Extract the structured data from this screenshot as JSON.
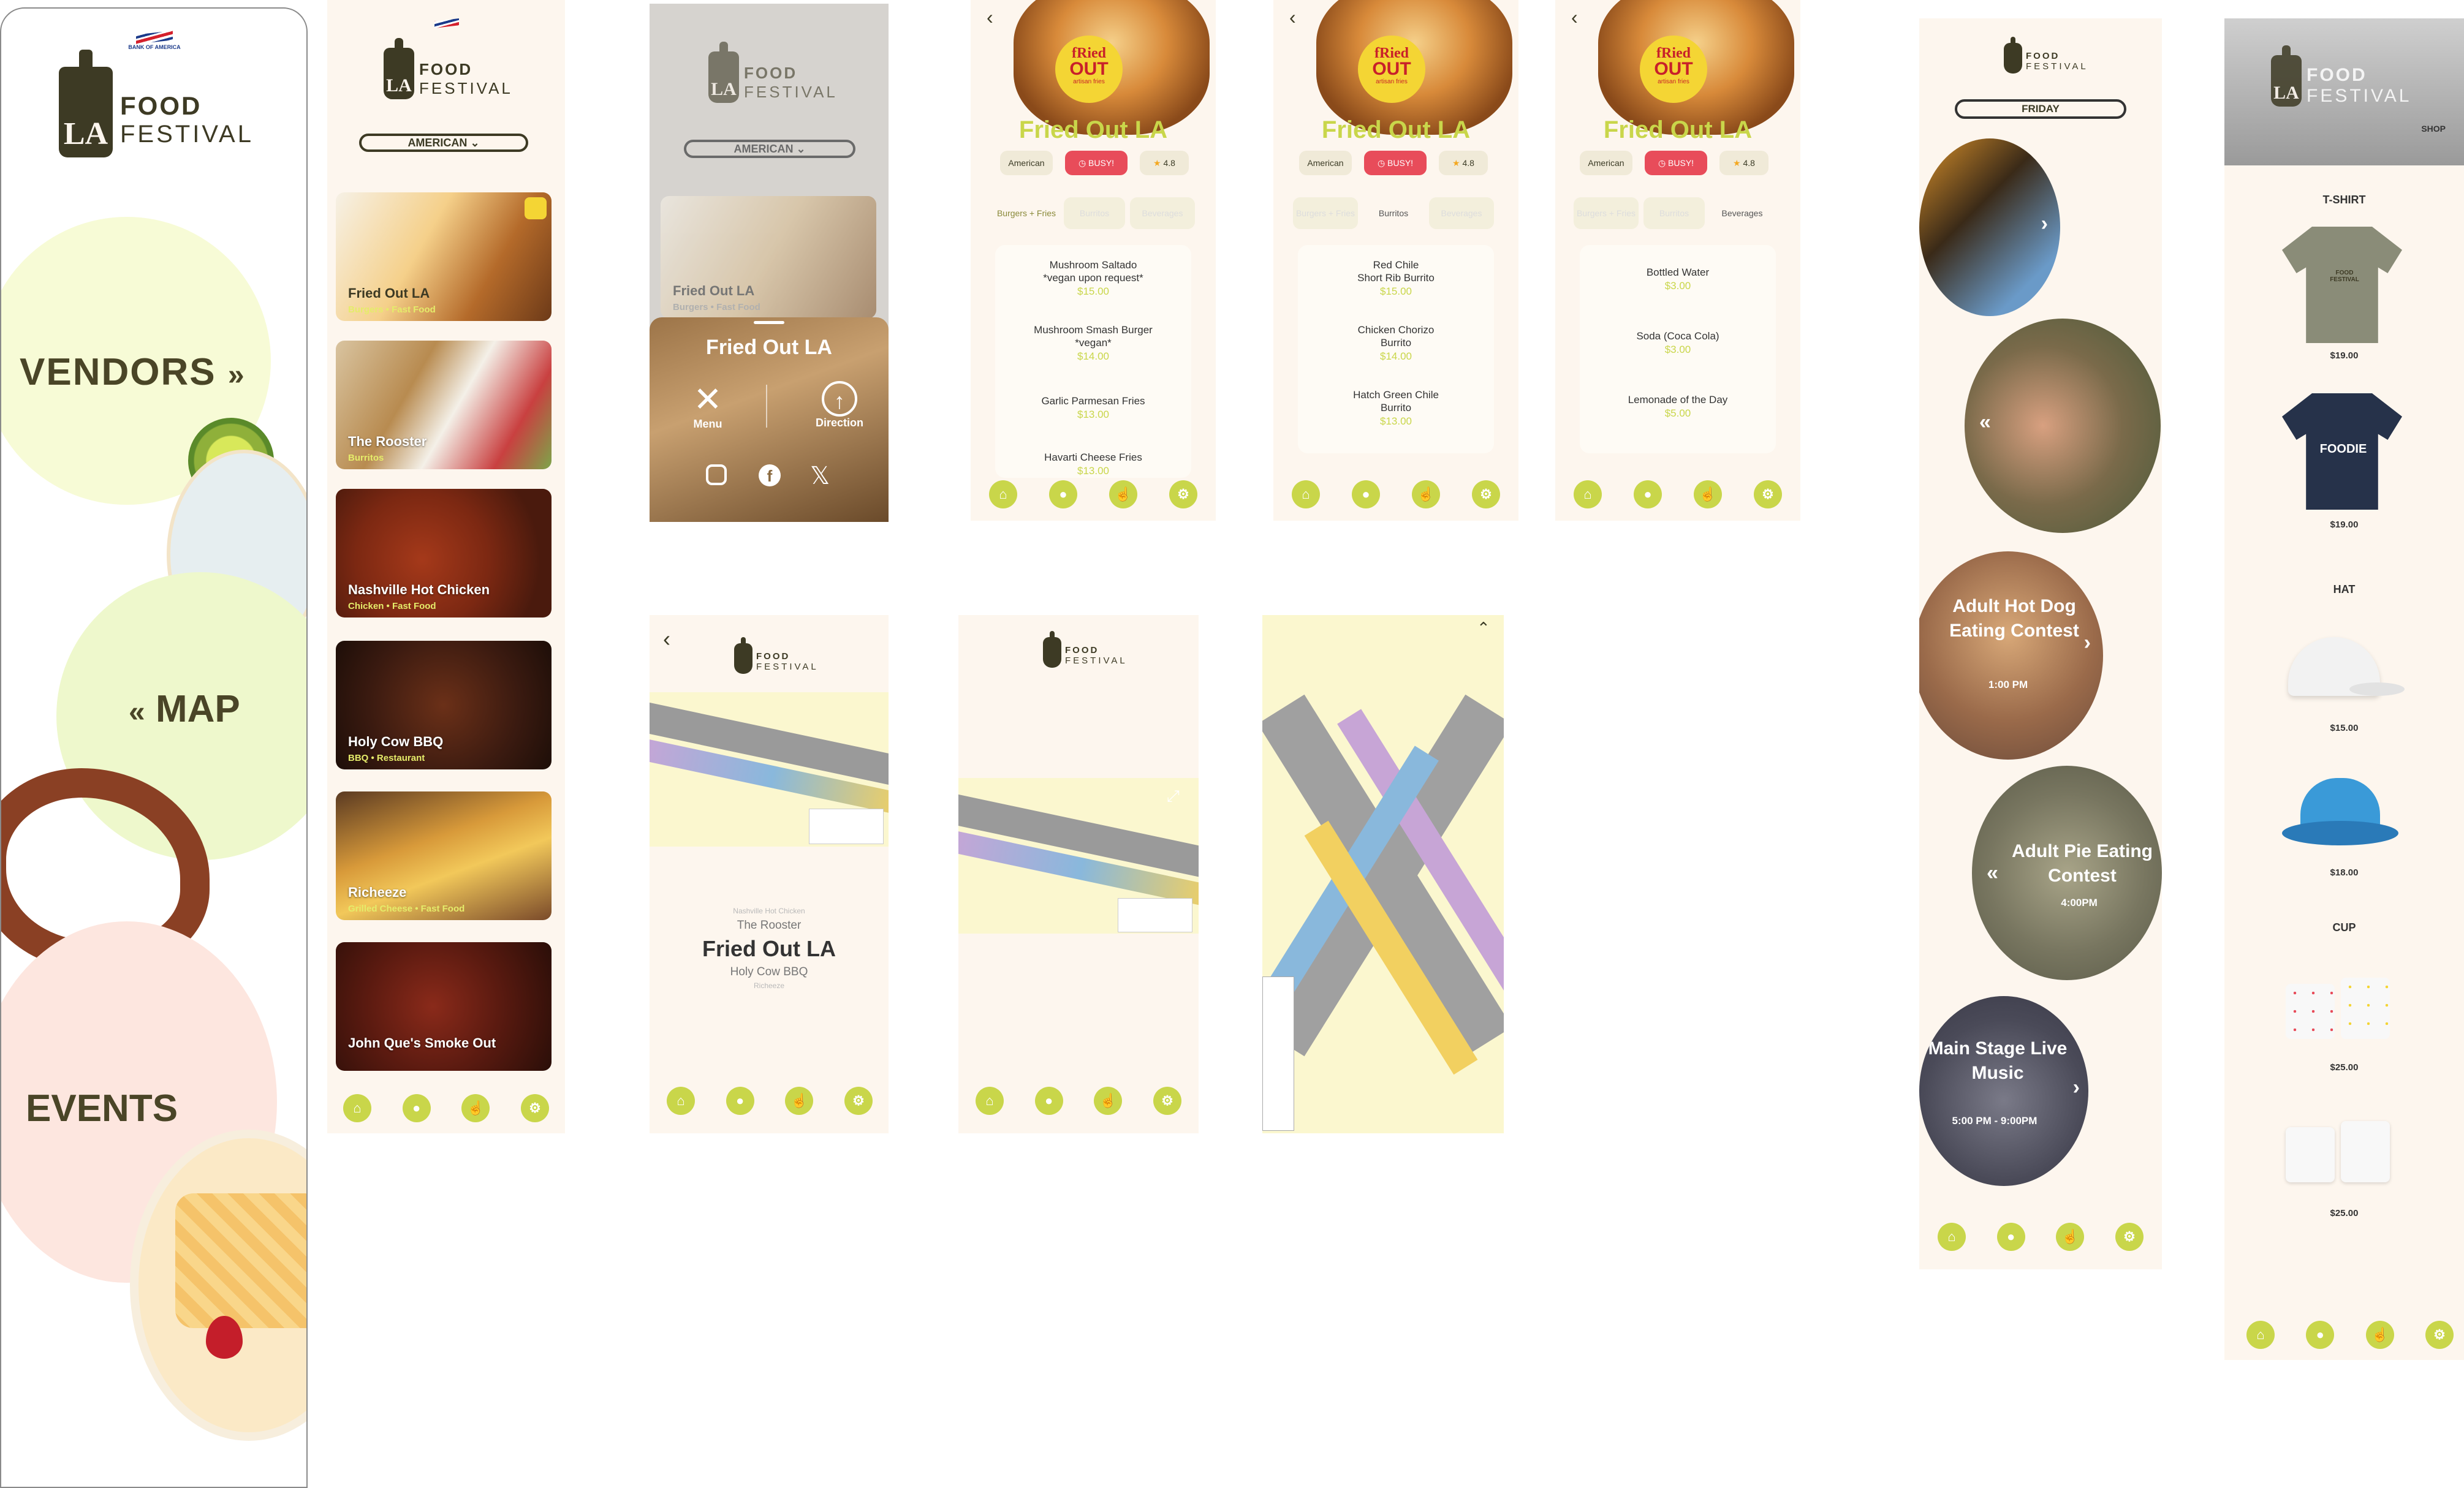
{
  "colors": {
    "accent": "#c9d64a",
    "dark": "#3d3a24",
    "busy": "#e84c5a",
    "cream": "#fdf6ee"
  },
  "brand": {
    "bank": "BANK OF AMERICA",
    "food": "FOOD",
    "festival": "FESTIVAL",
    "la": "LA",
    "shop": "SHOP"
  },
  "home": {
    "vendors": "VENDORS",
    "map": "MAP",
    "events": "EVENTS",
    "vendors_icon": "chevron-double-right-icon",
    "map_icon": "chevron-double-left-icon"
  },
  "vendor_list": {
    "filter": "AMERICAN",
    "cards": [
      {
        "name": "Fried Out LA",
        "category": "Burgers  •  Fast Food"
      },
      {
        "name": "The Rooster",
        "category": "Burritos"
      },
      {
        "name": "Nashville Hot Chicken",
        "category": "Chicken  •  Fast Food"
      },
      {
        "name": "Holy Cow BBQ",
        "category": "BBQ  •  Restaurant"
      },
      {
        "name": "Richeeze",
        "category": "Grilled Cheese  •  Fast Food"
      },
      {
        "name": "John Que's Smoke Out",
        "category": ""
      }
    ]
  },
  "vendor_overlay": {
    "filter": "AMERICAN",
    "card_name": "Fried Out LA",
    "card_category": "Burgers  •  Fast Food",
    "title": "Fried Out LA",
    "menu": "Menu",
    "direction": "Direction"
  },
  "vendor_detail": {
    "logo_top": "fRied",
    "logo_mid": "OUT",
    "logo_sub": "artisan fries",
    "title": "Fried Out LA",
    "cuisine": "American",
    "busy": "BUSY!",
    "rating": "4.8",
    "tabs": [
      "Burgers + Fries",
      "Burritos",
      "Beverages"
    ],
    "burgers": [
      {
        "name": "Mushroom Saltado\n*vegan upon request*",
        "price": "$15.00"
      },
      {
        "name": "Mushroom Smash Burger\n*vegan*",
        "price": "$14.00"
      },
      {
        "name": "Garlic Parmesan Fries",
        "price": "$13.00"
      },
      {
        "name": "Havarti Cheese Fries",
        "price": "$13.00"
      }
    ],
    "burritos": [
      {
        "name": "Red Chile\nShort Rib Burrito",
        "price": "$15.00"
      },
      {
        "name": "Chicken Chorizo\nBurrito",
        "price": "$14.00"
      },
      {
        "name": "Hatch Green Chile\nBurrito",
        "price": "$13.00"
      }
    ],
    "beverages": [
      {
        "name": "Bottled Water",
        "price": "$3.00"
      },
      {
        "name": "Soda (Coca Cola)",
        "price": "$3.00"
      },
      {
        "name": "Lemonade of the Day",
        "price": "$5.00"
      }
    ]
  },
  "map_picker": {
    "items": [
      "Nashville Hot Chicken",
      "The Rooster",
      "Fried Out LA",
      "Holy Cow BBQ",
      "Richeeze"
    ]
  },
  "events": {
    "day": "FRIDAY",
    "items": [
      {
        "title": "Adult Hot Dog Eating Contest",
        "time": "1:00 PM"
      },
      {
        "title": "Adult Pie Eating Contest",
        "time": "4:00PM"
      },
      {
        "title": "Main Stage Live Music",
        "time": "5:00 PM - 9:00PM"
      }
    ]
  },
  "shop": {
    "sections": [
      {
        "title": "T-SHIRT",
        "items": [
          {
            "price": "$19.00",
            "print": "FOOD FESTIVAL"
          },
          {
            "price": "$19.00",
            "print": "FOODIE"
          }
        ]
      },
      {
        "title": "HAT",
        "items": [
          {
            "price": "$15.00"
          },
          {
            "price": "$18.00"
          }
        ]
      },
      {
        "title": "CUP",
        "items": [
          {
            "price": "$25.00"
          },
          {
            "price": "$25.00"
          }
        ]
      }
    ]
  },
  "nav_icons": [
    "home-icon",
    "location-pin-icon",
    "tap-icon",
    "settings-icon"
  ]
}
